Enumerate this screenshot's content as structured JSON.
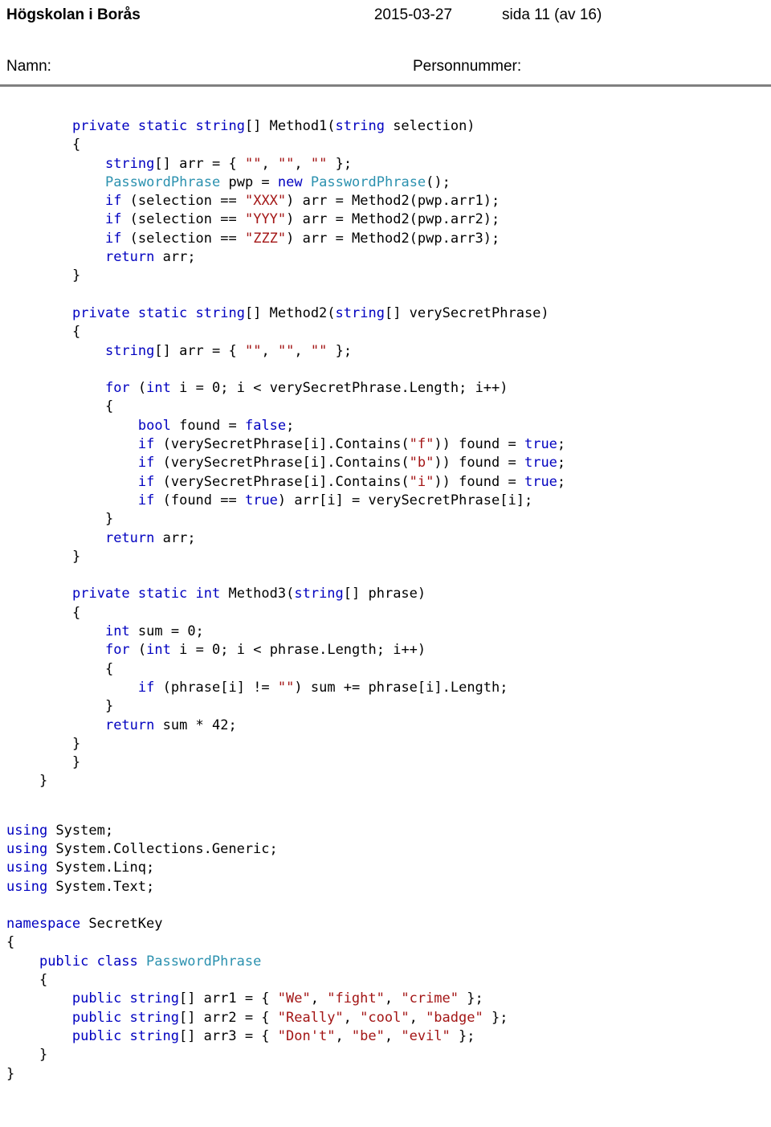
{
  "header": {
    "organization": "Högskolan i Borås",
    "date": "2015-03-27",
    "page": "sida 11 (av 16)"
  },
  "id_fields": {
    "name_label": "Namn:",
    "personal_number_label": "Personnummer:"
  },
  "colors": {
    "keyword": "#0000c0",
    "type": "#2b91af",
    "string": "#a31515",
    "plain": "#000000",
    "rule": "#808080"
  },
  "code_methods": [
    [
      {
        "t": "private static string",
        "c": "kw"
      },
      {
        "t": "[] Method1(",
        "c": "pln"
      },
      {
        "t": "string",
        "c": "kw"
      },
      {
        "t": " selection)",
        "c": "pln"
      }
    ],
    [
      {
        "t": "{",
        "c": "pln"
      }
    ],
    [
      {
        "t": "    ",
        "c": "pln"
      },
      {
        "t": "string",
        "c": "kw"
      },
      {
        "t": "[] arr = { ",
        "c": "pln"
      },
      {
        "t": "\"\"",
        "c": "str"
      },
      {
        "t": ", ",
        "c": "pln"
      },
      {
        "t": "\"\"",
        "c": "str"
      },
      {
        "t": ", ",
        "c": "pln"
      },
      {
        "t": "\"\"",
        "c": "str"
      },
      {
        "t": " };",
        "c": "pln"
      }
    ],
    [
      {
        "t": "    ",
        "c": "pln"
      },
      {
        "t": "PasswordPhrase",
        "c": "typ"
      },
      {
        "t": " pwp = ",
        "c": "pln"
      },
      {
        "t": "new",
        "c": "kw"
      },
      {
        "t": " ",
        "c": "pln"
      },
      {
        "t": "PasswordPhrase",
        "c": "typ"
      },
      {
        "t": "();",
        "c": "pln"
      }
    ],
    [
      {
        "t": "    ",
        "c": "pln"
      },
      {
        "t": "if",
        "c": "kw"
      },
      {
        "t": " (selection == ",
        "c": "pln"
      },
      {
        "t": "\"XXX\"",
        "c": "str"
      },
      {
        "t": ") arr = Method2(pwp.arr1);",
        "c": "pln"
      }
    ],
    [
      {
        "t": "    ",
        "c": "pln"
      },
      {
        "t": "if",
        "c": "kw"
      },
      {
        "t": " (selection == ",
        "c": "pln"
      },
      {
        "t": "\"YYY\"",
        "c": "str"
      },
      {
        "t": ") arr = Method2(pwp.arr2);",
        "c": "pln"
      }
    ],
    [
      {
        "t": "    ",
        "c": "pln"
      },
      {
        "t": "if",
        "c": "kw"
      },
      {
        "t": " (selection == ",
        "c": "pln"
      },
      {
        "t": "\"ZZZ\"",
        "c": "str"
      },
      {
        "t": ") arr = Method2(pwp.arr3);",
        "c": "pln"
      }
    ],
    [
      {
        "t": "    ",
        "c": "pln"
      },
      {
        "t": "return",
        "c": "kw"
      },
      {
        "t": " arr;",
        "c": "pln"
      }
    ],
    [
      {
        "t": "}",
        "c": "pln"
      }
    ],
    [],
    [
      {
        "t": "private static string",
        "c": "kw"
      },
      {
        "t": "[] Method2(",
        "c": "pln"
      },
      {
        "t": "string",
        "c": "kw"
      },
      {
        "t": "[] verySecretPhrase)",
        "c": "pln"
      }
    ],
    [
      {
        "t": "{",
        "c": "pln"
      }
    ],
    [
      {
        "t": "    ",
        "c": "pln"
      },
      {
        "t": "string",
        "c": "kw"
      },
      {
        "t": "[] arr = { ",
        "c": "pln"
      },
      {
        "t": "\"\"",
        "c": "str"
      },
      {
        "t": ", ",
        "c": "pln"
      },
      {
        "t": "\"\"",
        "c": "str"
      },
      {
        "t": ", ",
        "c": "pln"
      },
      {
        "t": "\"\"",
        "c": "str"
      },
      {
        "t": " };",
        "c": "pln"
      }
    ],
    [],
    [
      {
        "t": "    ",
        "c": "pln"
      },
      {
        "t": "for",
        "c": "kw"
      },
      {
        "t": " (",
        "c": "pln"
      },
      {
        "t": "int",
        "c": "kw"
      },
      {
        "t": " i = 0; i < verySecretPhrase.Length; i++)",
        "c": "pln"
      }
    ],
    [
      {
        "t": "    {",
        "c": "pln"
      }
    ],
    [
      {
        "t": "        ",
        "c": "pln"
      },
      {
        "t": "bool",
        "c": "kw"
      },
      {
        "t": " found = ",
        "c": "pln"
      },
      {
        "t": "false",
        "c": "kw"
      },
      {
        "t": ";",
        "c": "pln"
      }
    ],
    [
      {
        "t": "        ",
        "c": "pln"
      },
      {
        "t": "if",
        "c": "kw"
      },
      {
        "t": " (verySecretPhrase[i].Contains(",
        "c": "pln"
      },
      {
        "t": "\"f\"",
        "c": "str"
      },
      {
        "t": ")) found = ",
        "c": "pln"
      },
      {
        "t": "true",
        "c": "kw"
      },
      {
        "t": ";",
        "c": "pln"
      }
    ],
    [
      {
        "t": "        ",
        "c": "pln"
      },
      {
        "t": "if",
        "c": "kw"
      },
      {
        "t": " (verySecretPhrase[i].Contains(",
        "c": "pln"
      },
      {
        "t": "\"b\"",
        "c": "str"
      },
      {
        "t": ")) found = ",
        "c": "pln"
      },
      {
        "t": "true",
        "c": "kw"
      },
      {
        "t": ";",
        "c": "pln"
      }
    ],
    [
      {
        "t": "        ",
        "c": "pln"
      },
      {
        "t": "if",
        "c": "kw"
      },
      {
        "t": " (verySecretPhrase[i].Contains(",
        "c": "pln"
      },
      {
        "t": "\"i\"",
        "c": "str"
      },
      {
        "t": ")) found = ",
        "c": "pln"
      },
      {
        "t": "true",
        "c": "kw"
      },
      {
        "t": ";",
        "c": "pln"
      }
    ],
    [
      {
        "t": "        ",
        "c": "pln"
      },
      {
        "t": "if",
        "c": "kw"
      },
      {
        "t": " (found == ",
        "c": "pln"
      },
      {
        "t": "true",
        "c": "kw"
      },
      {
        "t": ") arr[i] = verySecretPhrase[i];",
        "c": "pln"
      }
    ],
    [
      {
        "t": "    }",
        "c": "pln"
      }
    ],
    [
      {
        "t": "    ",
        "c": "pln"
      },
      {
        "t": "return",
        "c": "kw"
      },
      {
        "t": " arr;",
        "c": "pln"
      }
    ],
    [
      {
        "t": "}",
        "c": "pln"
      }
    ],
    [],
    [
      {
        "t": "private static int",
        "c": "kw"
      },
      {
        "t": " Method3(",
        "c": "pln"
      },
      {
        "t": "string",
        "c": "kw"
      },
      {
        "t": "[] phrase)",
        "c": "pln"
      }
    ],
    [
      {
        "t": "{",
        "c": "pln"
      }
    ],
    [
      {
        "t": "    ",
        "c": "pln"
      },
      {
        "t": "int",
        "c": "kw"
      },
      {
        "t": " sum = 0;",
        "c": "pln"
      }
    ],
    [
      {
        "t": "    ",
        "c": "pln"
      },
      {
        "t": "for",
        "c": "kw"
      },
      {
        "t": " (",
        "c": "pln"
      },
      {
        "t": "int",
        "c": "kw"
      },
      {
        "t": " i = 0; i < phrase.Length; i++)",
        "c": "pln"
      }
    ],
    [
      {
        "t": "    {",
        "c": "pln"
      }
    ],
    [
      {
        "t": "        ",
        "c": "pln"
      },
      {
        "t": "if",
        "c": "kw"
      },
      {
        "t": " (phrase[i] != ",
        "c": "pln"
      },
      {
        "t": "\"\"",
        "c": "str"
      },
      {
        "t": ") sum += phrase[i].Length;",
        "c": "pln"
      }
    ],
    [
      {
        "t": "    }",
        "c": "pln"
      }
    ],
    [
      {
        "t": "    ",
        "c": "pln"
      },
      {
        "t": "return",
        "c": "kw"
      },
      {
        "t": " sum * 42;",
        "c": "pln"
      }
    ],
    [
      {
        "t": "}",
        "c": "pln"
      }
    ],
    [
      {
        "t": "        }",
        "c": "pln",
        "outdent": true
      }
    ],
    [
      {
        "t": "    }",
        "c": "pln",
        "outdent": true
      }
    ]
  ],
  "code_methods_tail": [
    "    }",
    "}"
  ],
  "code_class": [
    [
      {
        "t": "using",
        "c": "kw"
      },
      {
        "t": " System;",
        "c": "pln"
      }
    ],
    [
      {
        "t": "using",
        "c": "kw"
      },
      {
        "t": " System.Collections.Generic;",
        "c": "pln"
      }
    ],
    [
      {
        "t": "using",
        "c": "kw"
      },
      {
        "t": " System.Linq;",
        "c": "pln"
      }
    ],
    [
      {
        "t": "using",
        "c": "kw"
      },
      {
        "t": " System.Text;",
        "c": "pln"
      }
    ],
    [],
    [
      {
        "t": "namespace",
        "c": "kw"
      },
      {
        "t": " SecretKey",
        "c": "pln"
      }
    ],
    [
      {
        "t": "{",
        "c": "pln"
      }
    ],
    [
      {
        "t": "    ",
        "c": "pln"
      },
      {
        "t": "public class",
        "c": "kw"
      },
      {
        "t": " ",
        "c": "pln"
      },
      {
        "t": "PasswordPhrase",
        "c": "typ"
      }
    ],
    [
      {
        "t": "    {",
        "c": "pln"
      }
    ],
    [
      {
        "t": "        ",
        "c": "pln"
      },
      {
        "t": "public string",
        "c": "kw"
      },
      {
        "t": "[] arr1 = { ",
        "c": "pln"
      },
      {
        "t": "\"We\"",
        "c": "str"
      },
      {
        "t": ", ",
        "c": "pln"
      },
      {
        "t": "\"fight\"",
        "c": "str"
      },
      {
        "t": ", ",
        "c": "pln"
      },
      {
        "t": "\"crime\"",
        "c": "str"
      },
      {
        "t": " };",
        "c": "pln"
      }
    ],
    [
      {
        "t": "        ",
        "c": "pln"
      },
      {
        "t": "public string",
        "c": "kw"
      },
      {
        "t": "[] arr2 = { ",
        "c": "pln"
      },
      {
        "t": "\"Really\"",
        "c": "str"
      },
      {
        "t": ", ",
        "c": "pln"
      },
      {
        "t": "\"cool\"",
        "c": "str"
      },
      {
        "t": ", ",
        "c": "pln"
      },
      {
        "t": "\"badge\"",
        "c": "str"
      },
      {
        "t": " };",
        "c": "pln"
      }
    ],
    [
      {
        "t": "        ",
        "c": "pln"
      },
      {
        "t": "public string",
        "c": "kw"
      },
      {
        "t": "[] arr3 = { ",
        "c": "pln"
      },
      {
        "t": "\"Don't\"",
        "c": "str"
      },
      {
        "t": ", ",
        "c": "pln"
      },
      {
        "t": "\"be\"",
        "c": "str"
      },
      {
        "t": ", ",
        "c": "pln"
      },
      {
        "t": "\"evil\"",
        "c": "str"
      },
      {
        "t": " };",
        "c": "pln"
      }
    ],
    [
      {
        "t": "    }",
        "c": "pln"
      }
    ],
    [
      {
        "t": "}",
        "c": "pln"
      }
    ]
  ]
}
